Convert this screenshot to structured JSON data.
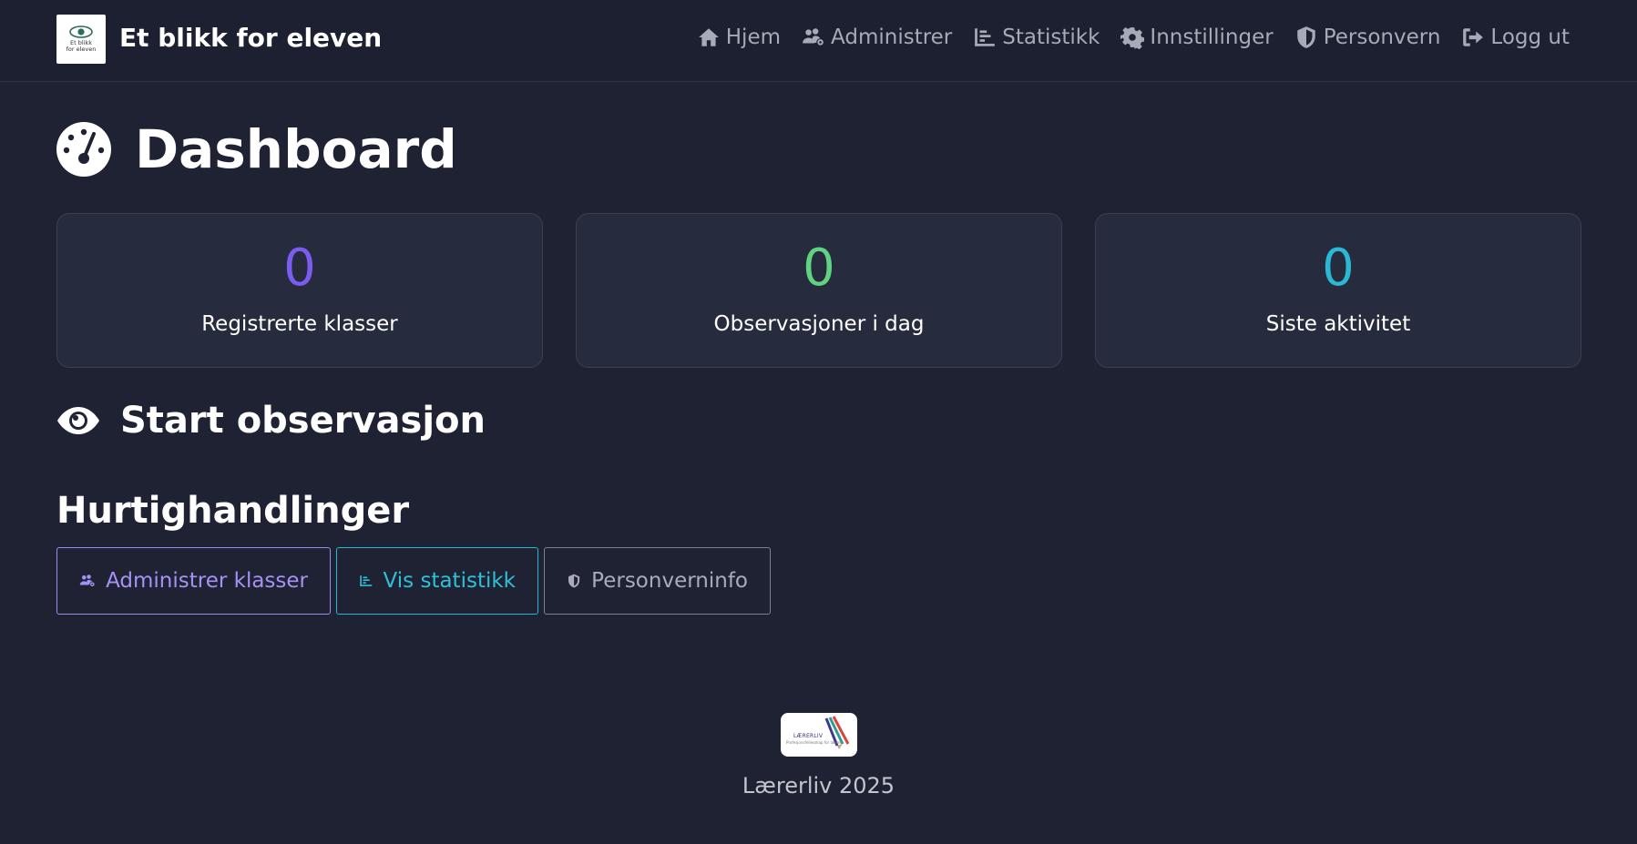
{
  "brand": {
    "logo_text": "Et blikk\nfor eleven",
    "name": "Et blikk for eleven"
  },
  "nav": [
    {
      "label": "Hjem",
      "icon": "home-icon"
    },
    {
      "label": "Administrer",
      "icon": "users-cog-icon"
    },
    {
      "label": "Statistikk",
      "icon": "bar-chart-icon"
    },
    {
      "label": "Innstillinger",
      "icon": "gear-icon"
    },
    {
      "label": "Personvern",
      "icon": "shield-icon"
    },
    {
      "label": "Logg ut",
      "icon": "logout-icon"
    }
  ],
  "page": {
    "title": "Dashboard",
    "icon": "dashboard-gauge-icon"
  },
  "stats": [
    {
      "value": "0",
      "label": "Registrerte klasser",
      "color": "#7a5cf0"
    },
    {
      "value": "0",
      "label": "Observasjoner i dag",
      "color": "#5fd37f"
    },
    {
      "value": "0",
      "label": "Siste aktivitet",
      "color": "#2bb8d4"
    }
  ],
  "start_section": {
    "title": "Start observasjon",
    "icon": "eye-icon"
  },
  "quick_actions": {
    "title": "Hurtighandlinger",
    "buttons": [
      {
        "label": "Administrer klasser",
        "icon": "users-cog-icon"
      },
      {
        "label": "Vis statistikk",
        "icon": "bar-chart-icon"
      },
      {
        "label": "Personverninfo",
        "icon": "shield-icon"
      }
    ]
  },
  "footer": {
    "logo_text": "LÆRERLIV",
    "logo_subtext": "Profesjonsfellesskap for lærere",
    "text": "Lærerliv 2025"
  }
}
